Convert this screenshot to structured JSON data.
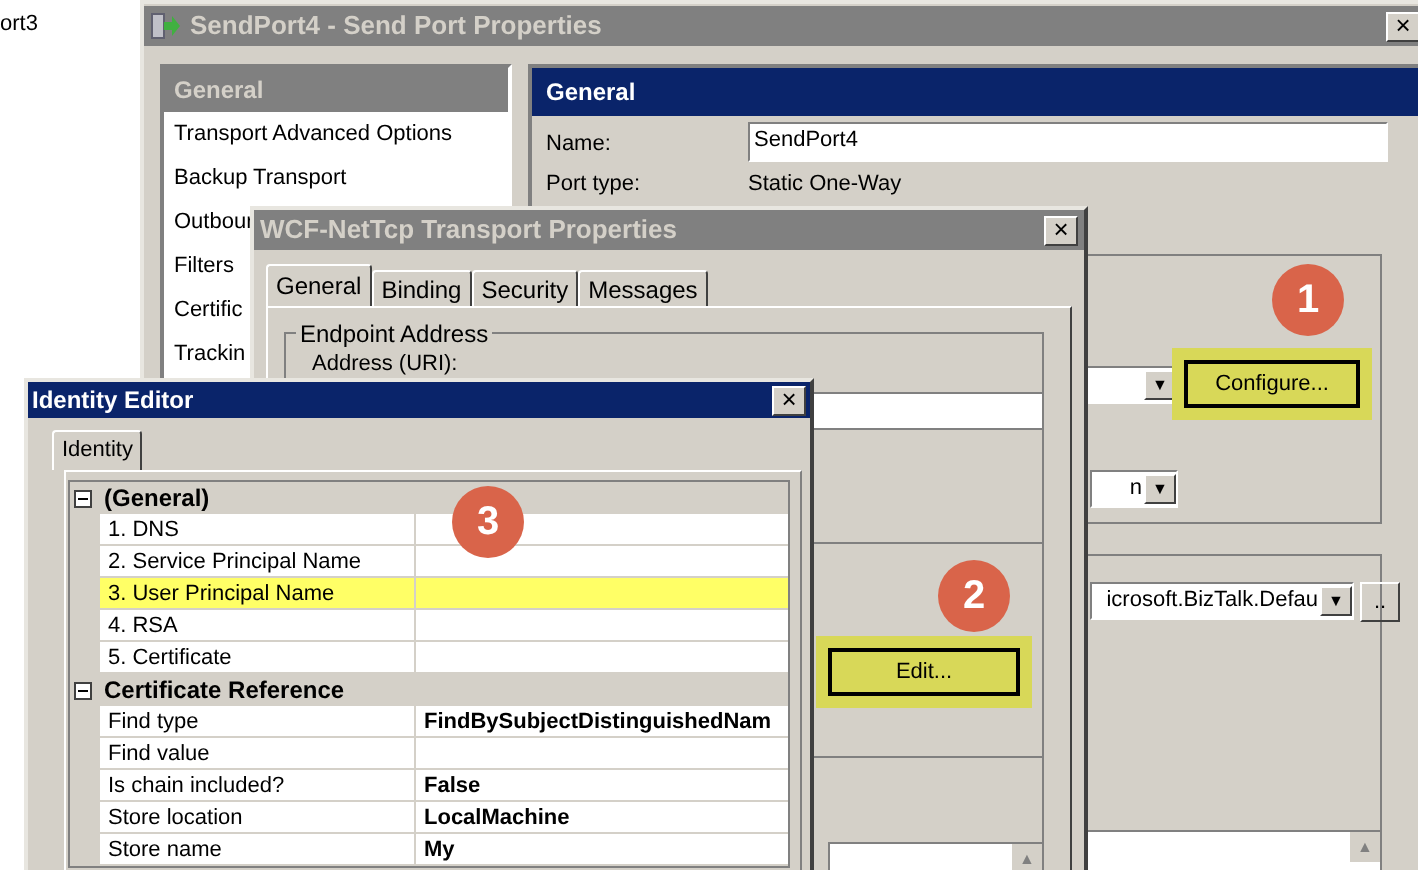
{
  "background_item": {
    "label": "ort3"
  },
  "send_port_window": {
    "title": "SendPort4 - Send Port Properties",
    "close": "×",
    "nav": [
      {
        "label": "General",
        "selected": true
      },
      {
        "label": "Transport Advanced Options",
        "selected": false
      },
      {
        "label": "Backup Transport",
        "selected": false
      },
      {
        "label": "Outbour",
        "selected": false
      },
      {
        "label": "Filters",
        "selected": false
      },
      {
        "label": "Certific",
        "selected": false
      },
      {
        "label": "Trackin",
        "selected": false
      }
    ],
    "header": "General",
    "name_label": "Name:",
    "name_value": "SendPort4",
    "port_type_label": "Port type:",
    "port_type_value": "Static One-Way",
    "transport_button": {
      "label": "Configure...",
      "highlighted": true,
      "badge": "1"
    },
    "transport_combo_arrow": "▼",
    "second_combo": {
      "value": "n",
      "arrow": "▼"
    },
    "pipeline_combo": {
      "value": "icrosoft.BizTalk.Defau",
      "arrow": "▼"
    },
    "browse_button": "..",
    "list_scroll": "▲"
  },
  "wcf_window": {
    "title": "WCF-NetTcp Transport Properties",
    "close": "×",
    "tabs": [
      {
        "label": "General",
        "selected": true
      },
      {
        "label": "Binding",
        "selected": false
      },
      {
        "label": "Security",
        "selected": false
      },
      {
        "label": "Messages",
        "selected": false
      }
    ],
    "group": "Endpoint Address",
    "address_label": "Address (URI):",
    "edit_button": {
      "label": "Edit...",
      "highlighted": true,
      "badge": "2"
    },
    "list_scroll": "▲"
  },
  "identity_editor": {
    "title": "Identity Editor",
    "close": "×",
    "tabs": [
      {
        "label": "Identity",
        "selected": true
      }
    ],
    "badge": "3",
    "rows": [
      {
        "kind": "category",
        "label": "(General)",
        "expanded": true
      },
      {
        "kind": "property",
        "label": "1. DNS",
        "highlighted": false
      },
      {
        "kind": "property",
        "label": "2. Service Principal Name",
        "highlighted": false
      },
      {
        "kind": "property",
        "label": "3. User Principal Name",
        "highlighted": true
      },
      {
        "kind": "property",
        "label": "4. RSA",
        "highlighted": false
      },
      {
        "kind": "property",
        "label": "5. Certificate",
        "highlighted": false
      },
      {
        "kind": "category",
        "label": "Certificate Reference",
        "expanded": true
      },
      {
        "kind": "property",
        "label": "Find type",
        "value": "FindBySubjectDistinguishedNam",
        "highlighted": false
      },
      {
        "kind": "property",
        "label": "Find value",
        "highlighted": false
      },
      {
        "kind": "property",
        "label": "Is chain included?",
        "value": "False",
        "highlighted": false
      },
      {
        "kind": "property",
        "label": "Store location",
        "value": "LocalMachine",
        "highlighted": false
      },
      {
        "kind": "property",
        "label": "Store name",
        "value": "My",
        "highlighted": false
      }
    ]
  }
}
